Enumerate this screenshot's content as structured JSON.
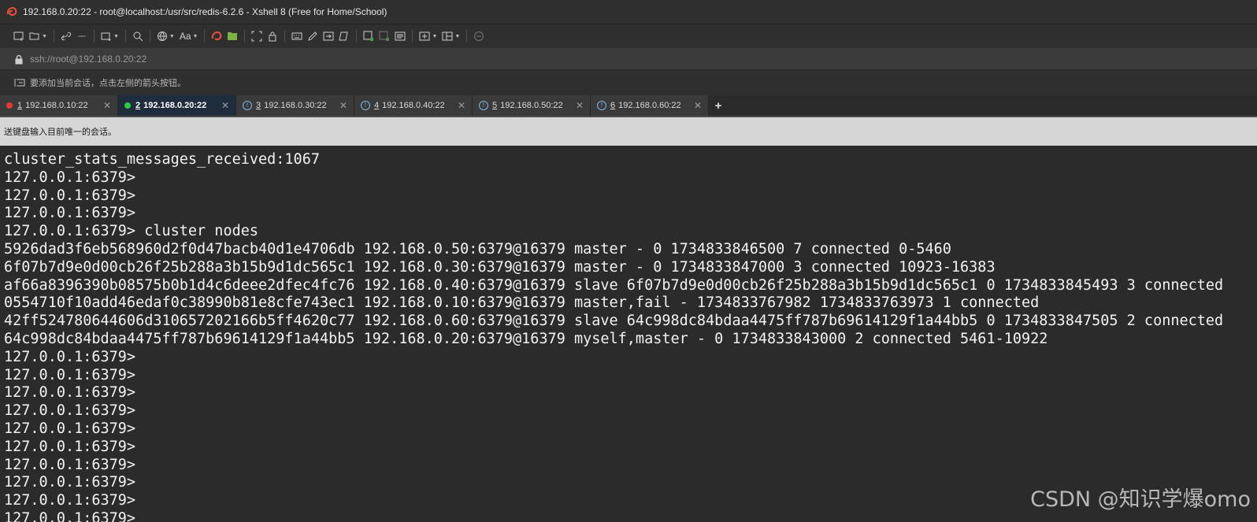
{
  "window": {
    "title": "192.168.0.20:22 - root@localhost:/usr/src/redis-6.2.6 - Xshell 8 (Free for Home/School)"
  },
  "address": {
    "url": "ssh://root@192.168.0.20:22"
  },
  "hint": {
    "text": "要添加当前会话，点击左侧的箭头按钮。"
  },
  "tabs": [
    {
      "num": "1",
      "label": "192.168.0.10:22",
      "status": "red-dot"
    },
    {
      "num": "2",
      "label": "192.168.0.20:22",
      "status": "green-dot"
    },
    {
      "num": "3",
      "label": "192.168.0.30:22",
      "status": "warning"
    },
    {
      "num": "4",
      "label": "192.168.0.40:22",
      "status": "warning"
    },
    {
      "num": "5",
      "label": "192.168.0.50:22",
      "status": "warning"
    },
    {
      "num": "6",
      "label": "192.168.0.60:22",
      "status": "warning"
    }
  ],
  "tab_add_label": "+",
  "sendbar": {
    "text": "送键盘输入目前唯一的会话。"
  },
  "terminal": {
    "lines": [
      "cluster_stats_messages_received:1067",
      "127.0.0.1:6379>",
      "127.0.0.1:6379>",
      "127.0.0.1:6379>",
      "127.0.0.1:6379> cluster nodes",
      "5926dad3f6eb568960d2f0d47bacb40d1e4706db 192.168.0.50:6379@16379 master - 0 1734833846500 7 connected 0-5460",
      "6f07b7d9e0d00cb26f25b288a3b15b9d1dc565c1 192.168.0.30:6379@16379 master - 0 1734833847000 3 connected 10923-16383",
      "af66a8396390b08575b0b1d4c6deee2dfec4fc76 192.168.0.40:6379@16379 slave 6f07b7d9e0d00cb26f25b288a3b15b9d1dc565c1 0 1734833845493 3 connected",
      "0554710f10add46edaf0c38990b81e8cfe743ec1 192.168.0.10:6379@16379 master,fail - 1734833767982 1734833763973 1 connected",
      "42ff524780644606d310657202166b5ff4620c77 192.168.0.60:6379@16379 slave 64c998dc84bdaa4475ff787b69614129f1a44bb5 0 1734833847505 2 connected",
      "64c998dc84bdaa4475ff787b69614129f1a44bb5 192.168.0.20:6379@16379 myself,master - 0 1734833843000 2 connected 5461-10922",
      "127.0.0.1:6379>",
      "127.0.0.1:6379>",
      "127.0.0.1:6379>",
      "127.0.0.1:6379>",
      "127.0.0.1:6379>",
      "127.0.0.1:6379>",
      "127.0.0.1:6379>",
      "127.0.0.1:6379>",
      "127.0.0.1:6379>",
      "127.0.0.1:6379>"
    ]
  },
  "watermark": "CSDN @知识学爆omo",
  "colors": {
    "tab_active_bg": "#1f2c3d",
    "dot_red": "#e53935",
    "dot_green": "#2ecc40",
    "warning_blue": "#7fb6e6"
  }
}
